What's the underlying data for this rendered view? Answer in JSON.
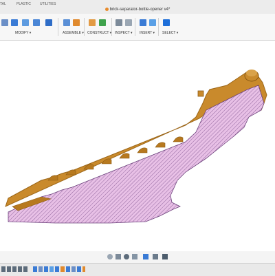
{
  "window": {
    "title": "brick-separator-bottle-opener v4*"
  },
  "tabs": [
    {
      "label": "TAL"
    },
    {
      "label": "PLASTIC"
    },
    {
      "label": "UTILITIES"
    }
  ],
  "toolbar": {
    "groups": [
      {
        "label": "MODIFY ▾"
      },
      {
        "label": "ASSEMBLE ▾"
      },
      {
        "label": "CONSTRUCT ▾"
      },
      {
        "label": "INSPECT ▾"
      },
      {
        "label": "INSERT ▾"
      },
      {
        "label": "SELECT ▾"
      }
    ],
    "colors": {
      "blue": "#3a7bd5",
      "orange": "#e08a2e",
      "green": "#3fa34d",
      "select_accent": "#1e6fd9"
    }
  },
  "model": {
    "body_color": "#c98a2c",
    "body_shadow": "#9c6618",
    "section_fill": "#e8c0e6",
    "hatch_color": "#7a4f8a"
  },
  "navbar": {
    "icons": [
      "orbit-icon",
      "pan-icon",
      "zoom-icon",
      "fit-icon",
      "display-settings-icon",
      "grid-icon",
      "viewports-icon"
    ]
  },
  "timeline": {
    "controls": [
      "first-icon",
      "previous-icon",
      "play-icon",
      "next-icon",
      "last-icon"
    ]
  }
}
